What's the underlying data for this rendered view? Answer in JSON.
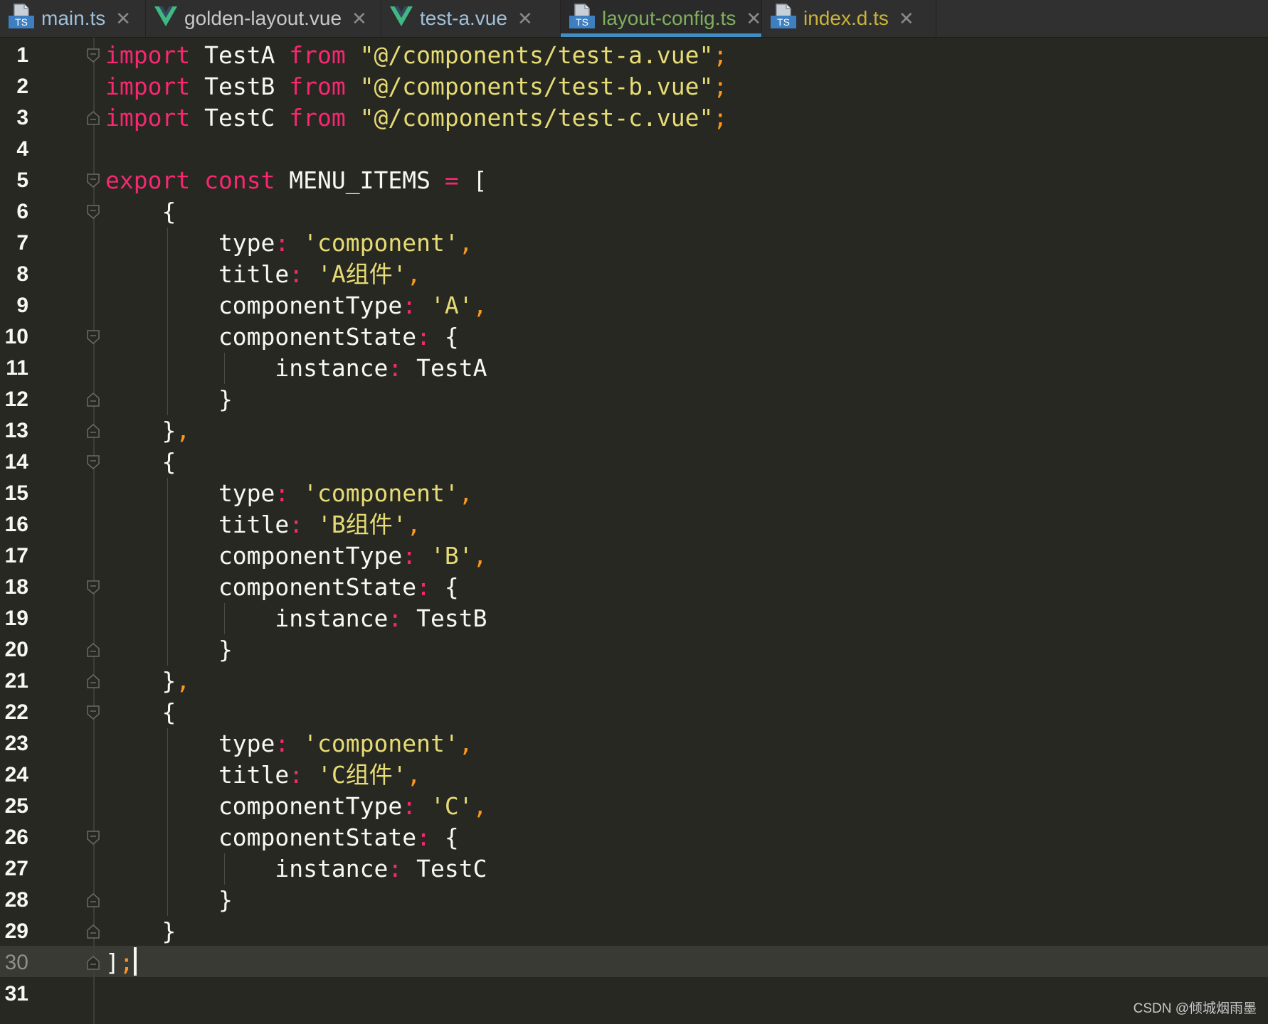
{
  "tabs": [
    {
      "label": "main.ts",
      "icon": "typescript-file-icon",
      "label_color": "#9fc0da",
      "active": false
    },
    {
      "label": "golden-layout.vue",
      "icon": "vue-file-icon",
      "label_color": "#c8c8c8",
      "active": false
    },
    {
      "label": "test-a.vue",
      "icon": "vue-file-icon",
      "label_color": "#9fc0da",
      "active": false
    },
    {
      "label": "layout-config.ts",
      "icon": "typescript-file-icon",
      "label_color": "#7faf5f",
      "active": true
    },
    {
      "label": "index.d.ts",
      "icon": "typescript-file-icon",
      "label_color": "#c9b43a",
      "active": false
    }
  ],
  "ts_icon_text": "TS",
  "close_glyph": "✕",
  "editor": {
    "current_line": 30,
    "lines": [
      {
        "n": "1",
        "t": [
          [
            "kw",
            "import"
          ],
          [
            "p",
            " TestA "
          ],
          [
            "kw",
            "from"
          ],
          [
            "p",
            " "
          ],
          [
            "st",
            "\"@/components/test-a.vue\""
          ],
          [
            "pu",
            ";"
          ]
        ]
      },
      {
        "n": "2",
        "t": [
          [
            "kw",
            "import"
          ],
          [
            "p",
            " TestB "
          ],
          [
            "kw",
            "from"
          ],
          [
            "p",
            " "
          ],
          [
            "st",
            "\"@/components/test-b.vue\""
          ],
          [
            "pu",
            ";"
          ]
        ]
      },
      {
        "n": "3",
        "t": [
          [
            "kw",
            "import"
          ],
          [
            "p",
            " TestC "
          ],
          [
            "kw",
            "from"
          ],
          [
            "p",
            " "
          ],
          [
            "st",
            "\"@/components/test-c.vue\""
          ],
          [
            "pu",
            ";"
          ]
        ]
      },
      {
        "n": "4",
        "t": []
      },
      {
        "n": "5",
        "t": [
          [
            "kw",
            "export"
          ],
          [
            "p",
            " "
          ],
          [
            "kw",
            "const"
          ],
          [
            "p",
            " MENU_ITEMS "
          ],
          [
            "op",
            "="
          ],
          [
            "p",
            " ["
          ]
        ]
      },
      {
        "n": "6",
        "t": [
          [
            "p",
            "    {"
          ]
        ]
      },
      {
        "n": "7",
        "t": [
          [
            "p",
            "        type"
          ],
          [
            "op",
            ":"
          ],
          [
            "p",
            " "
          ],
          [
            "st",
            "'component'"
          ],
          [
            "pu",
            ","
          ]
        ]
      },
      {
        "n": "8",
        "t": [
          [
            "p",
            "        title"
          ],
          [
            "op",
            ":"
          ],
          [
            "p",
            " "
          ],
          [
            "st",
            "'A组件'"
          ],
          [
            "pu",
            ","
          ]
        ]
      },
      {
        "n": "9",
        "t": [
          [
            "p",
            "        componentType"
          ],
          [
            "op",
            ":"
          ],
          [
            "p",
            " "
          ],
          [
            "st",
            "'A'"
          ],
          [
            "pu",
            ","
          ]
        ]
      },
      {
        "n": "10",
        "t": [
          [
            "p",
            "        componentState"
          ],
          [
            "op",
            ":"
          ],
          [
            "p",
            " {"
          ]
        ]
      },
      {
        "n": "11",
        "t": [
          [
            "p",
            "            instance"
          ],
          [
            "op",
            ":"
          ],
          [
            "p",
            " TestA"
          ]
        ]
      },
      {
        "n": "12",
        "t": [
          [
            "p",
            "        }"
          ]
        ]
      },
      {
        "n": "13",
        "t": [
          [
            "p",
            "    }"
          ],
          [
            "pu",
            ","
          ]
        ]
      },
      {
        "n": "14",
        "t": [
          [
            "p",
            "    {"
          ]
        ]
      },
      {
        "n": "15",
        "t": [
          [
            "p",
            "        type"
          ],
          [
            "op",
            ":"
          ],
          [
            "p",
            " "
          ],
          [
            "st",
            "'component'"
          ],
          [
            "pu",
            ","
          ]
        ]
      },
      {
        "n": "16",
        "t": [
          [
            "p",
            "        title"
          ],
          [
            "op",
            ":"
          ],
          [
            "p",
            " "
          ],
          [
            "st",
            "'B组件'"
          ],
          [
            "pu",
            ","
          ]
        ]
      },
      {
        "n": "17",
        "t": [
          [
            "p",
            "        componentType"
          ],
          [
            "op",
            ":"
          ],
          [
            "p",
            " "
          ],
          [
            "st",
            "'B'"
          ],
          [
            "pu",
            ","
          ]
        ]
      },
      {
        "n": "18",
        "t": [
          [
            "p",
            "        componentState"
          ],
          [
            "op",
            ":"
          ],
          [
            "p",
            " {"
          ]
        ]
      },
      {
        "n": "19",
        "t": [
          [
            "p",
            "            instance"
          ],
          [
            "op",
            ":"
          ],
          [
            "p",
            " TestB"
          ]
        ]
      },
      {
        "n": "20",
        "t": [
          [
            "p",
            "        }"
          ]
        ]
      },
      {
        "n": "21",
        "t": [
          [
            "p",
            "    }"
          ],
          [
            "pu",
            ","
          ]
        ]
      },
      {
        "n": "22",
        "t": [
          [
            "p",
            "    {"
          ]
        ]
      },
      {
        "n": "23",
        "t": [
          [
            "p",
            "        type"
          ],
          [
            "op",
            ":"
          ],
          [
            "p",
            " "
          ],
          [
            "st",
            "'component'"
          ],
          [
            "pu",
            ","
          ]
        ]
      },
      {
        "n": "24",
        "t": [
          [
            "p",
            "        title"
          ],
          [
            "op",
            ":"
          ],
          [
            "p",
            " "
          ],
          [
            "st",
            "'C组件'"
          ],
          [
            "pu",
            ","
          ]
        ]
      },
      {
        "n": "25",
        "t": [
          [
            "p",
            "        componentType"
          ],
          [
            "op",
            ":"
          ],
          [
            "p",
            " "
          ],
          [
            "st",
            "'C'"
          ],
          [
            "pu",
            ","
          ]
        ]
      },
      {
        "n": "26",
        "t": [
          [
            "p",
            "        componentState"
          ],
          [
            "op",
            ":"
          ],
          [
            "p",
            " {"
          ]
        ]
      },
      {
        "n": "27",
        "t": [
          [
            "p",
            "            instance"
          ],
          [
            "op",
            ":"
          ],
          [
            "p",
            " TestC"
          ]
        ]
      },
      {
        "n": "28",
        "t": [
          [
            "p",
            "        }"
          ]
        ]
      },
      {
        "n": "29",
        "t": [
          [
            "p",
            "    }"
          ]
        ]
      },
      {
        "n": "30",
        "t": [
          [
            "p",
            "]"
          ],
          [
            "pu",
            ";"
          ]
        ]
      },
      {
        "n": "31",
        "t": []
      }
    ]
  },
  "watermark": "CSDN @倾城烟雨墨"
}
